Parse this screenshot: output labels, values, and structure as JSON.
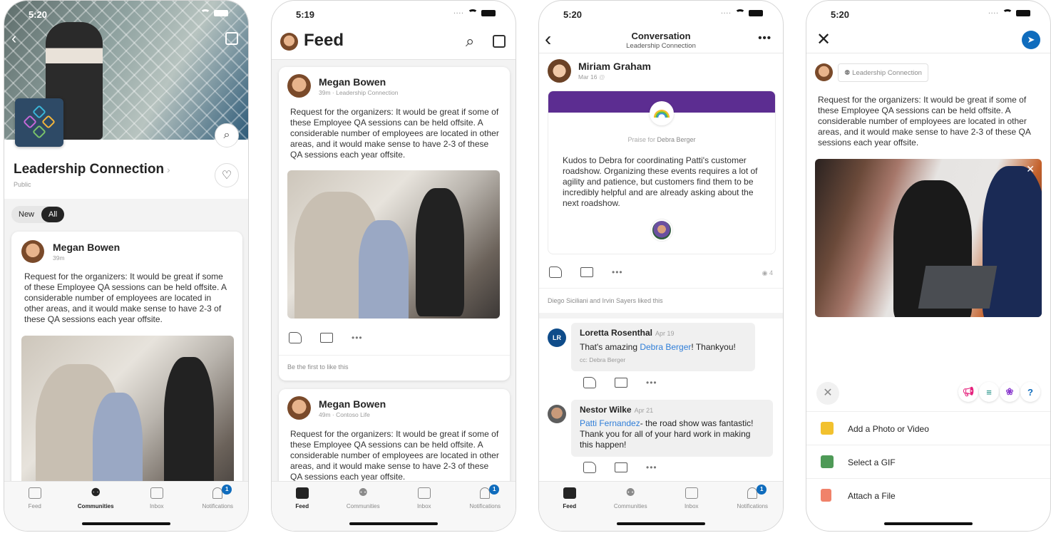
{
  "phones": [
    {
      "status_time": "5:20",
      "community": {
        "name": "Leadership Connection",
        "privacy": "Public"
      },
      "filters": [
        "New",
        "All"
      ],
      "active_filter": "All",
      "post": {
        "author": "Megan Bowen",
        "time": "39m",
        "text": "Request for the organizers: It would be great if some of these Employee QA sessions can be held offsite. A considerable number of employees are located in other areas, and it would make sense to have 2-3 of these QA sessions each year offsite."
      },
      "tabs": [
        {
          "label": "Feed",
          "icon": "feed-icon"
        },
        {
          "label": "Communities",
          "icon": "communities-icon"
        },
        {
          "label": "Inbox",
          "icon": "inbox-icon"
        },
        {
          "label": "Notifications",
          "icon": "bell-icon",
          "badge": "1"
        }
      ],
      "active_tab": "Communities"
    },
    {
      "status_time": "5:19",
      "title": "Feed",
      "posts": [
        {
          "author": "Megan Bowen",
          "meta": "39m · Leadership Connection",
          "text": "Request for the organizers: It would be great if some of these Employee QA sessions can be held offsite. A considerable number of employees are located in other areas, and it would make sense to have 2-3 of these QA sessions each year offsite.",
          "likes_text": "Be the first to like this"
        },
        {
          "author": "Megan Bowen",
          "meta": "49m · Contoso Life",
          "text": "Request for the organizers: It would be great if some of these Employee QA sessions can be held offsite. A considerable number of employees are located in other areas, and it would make sense to have 2-3 of these QA sessions each year offsite."
        }
      ],
      "tabs": [
        {
          "label": "Feed"
        },
        {
          "label": "Communities"
        },
        {
          "label": "Inbox"
        },
        {
          "label": "Notifications",
          "badge": "1"
        }
      ],
      "active_tab": "Feed"
    },
    {
      "status_time": "5:20",
      "title": "Conversation",
      "subtitle": "Leadership Connection",
      "post": {
        "author": "Miriam Graham",
        "date": "Mar 16",
        "praise_label": "Praise for",
        "praise_target": "Debra Berger",
        "text": "Kudos to Debra for coordinating Patti's customer roadshow. Organizing these events requires a lot of agility and patience, but customers find them to be incredibly helpful and are already asking about the next roadshow.",
        "views": "4",
        "likes_text": "Diego Siciliani and Irvin Sayers liked this"
      },
      "replies": [
        {
          "initials": "LR",
          "author": "Loretta  Rosenthal",
          "date": "Apr 19",
          "text_before": "That's amazing ",
          "mention": "Debra Berger",
          "text_after": "! Thankyou!",
          "cc": "cc: Debra Berger"
        },
        {
          "author": "Nestor Wilke",
          "date": "Apr 21",
          "mention": "Patti Fernandez",
          "text_after": "- the road show was fantastic! Thank you for all of your hard work in making this happen!"
        }
      ],
      "tabs": [
        {
          "label": "Feed"
        },
        {
          "label": "Communities"
        },
        {
          "label": "Inbox"
        },
        {
          "label": "Notifications",
          "badge": "1"
        }
      ],
      "active_tab": "Feed"
    },
    {
      "status_time": "5:20",
      "destination": "Leadership Connection",
      "text": "Request for the organizers: It would be great if some of these Employee QA sessions can be held offsite. A considerable number of employees are located in other areas, and it would make sense to have 2-3 of these QA sessions each year offsite.",
      "post_types": [
        "announcement-icon",
        "poll-icon",
        "praise-icon",
        "question-icon"
      ],
      "menu": [
        {
          "label": "Add a Photo or Video",
          "icon": "camera-icon",
          "color": "#f2c12e"
        },
        {
          "label": "Select a GIF",
          "icon": "gif-icon",
          "color": "#4e9a57"
        },
        {
          "label": "Attach a File",
          "icon": "file-icon",
          "color": "#f0826a"
        }
      ]
    }
  ],
  "colors": {
    "accent": "#0f6cbd",
    "praise_band": "#5c2d91",
    "link": "#2f7ed8"
  }
}
